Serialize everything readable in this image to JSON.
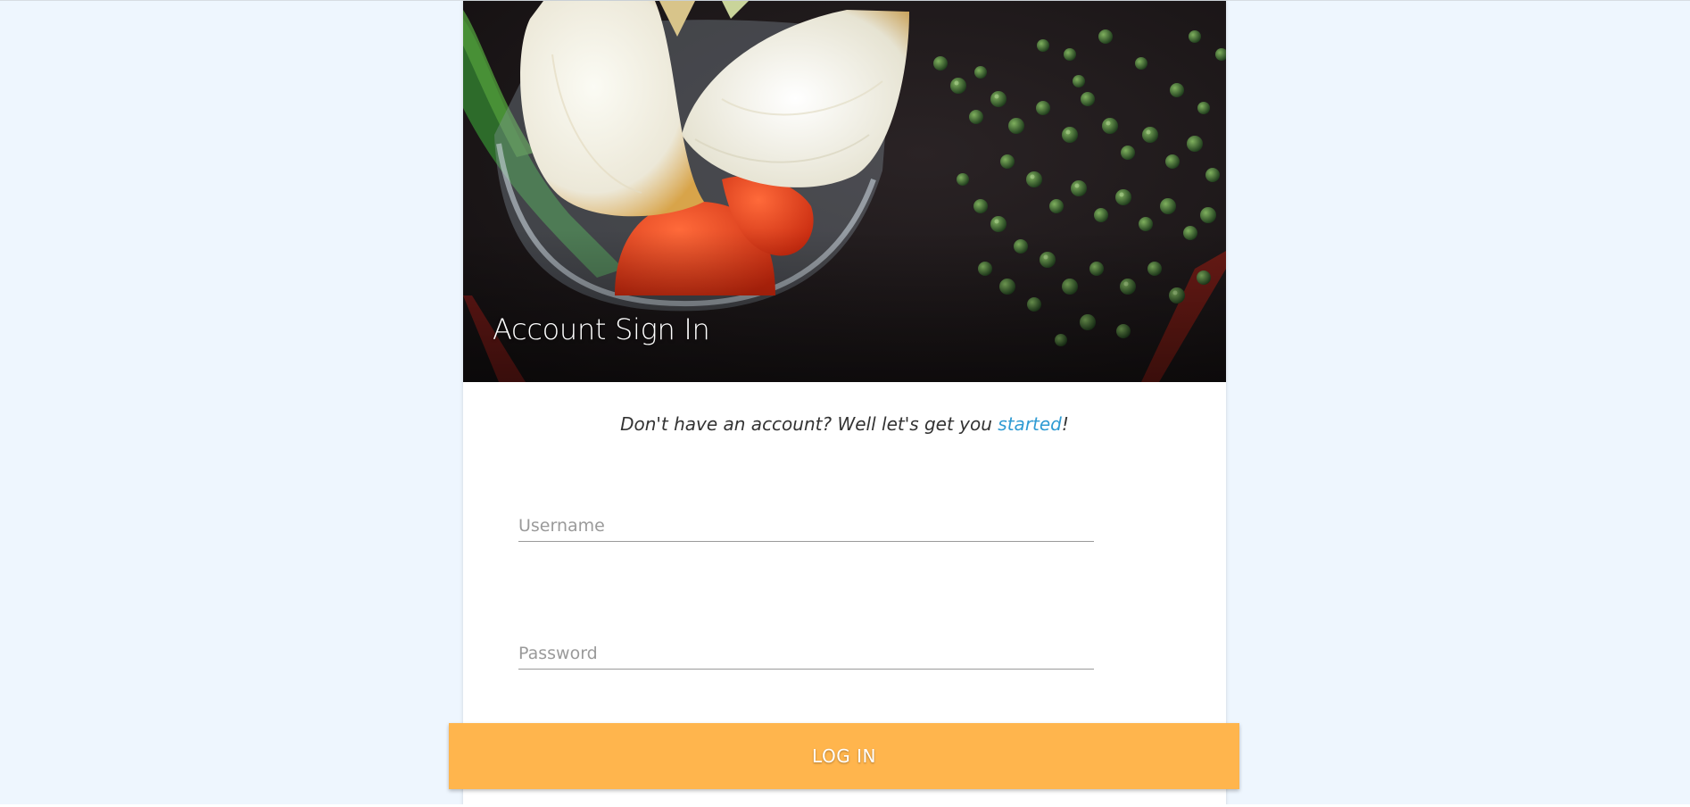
{
  "hero": {
    "title": "Account Sign In",
    "image": "vegetables-onion-tomato-peppercorn-photo"
  },
  "signup": {
    "prefix": "Don't have an account? Well let's get you ",
    "link_text": "started",
    "suffix": "!"
  },
  "form": {
    "username_placeholder": "Username",
    "username_value": "",
    "password_placeholder": "Password",
    "password_value": ""
  },
  "login_button": {
    "label": "LOG IN"
  },
  "colors": {
    "page_background": "#eef6fe",
    "card_background": "#ffffff",
    "accent_button": "#ffb54d",
    "link": "#2f9bd3"
  }
}
